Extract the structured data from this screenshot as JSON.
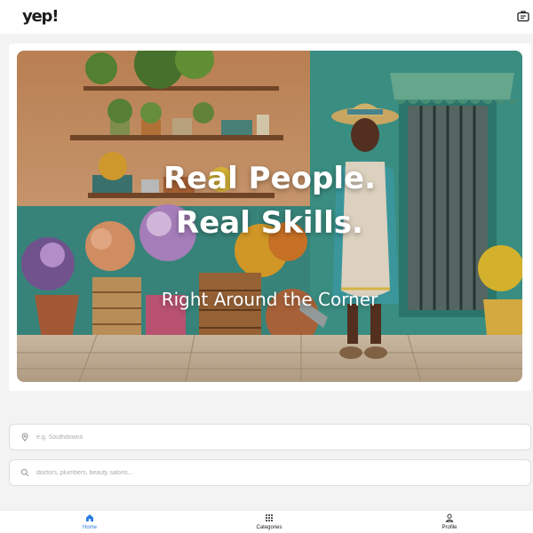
{
  "brand": {
    "logo_text": "yep!",
    "accent_color": "#2b7be0"
  },
  "header": {
    "right_icon": "briefcase-icon"
  },
  "hero": {
    "headline_line1": "Real People.",
    "headline_line2": "Real Skills.",
    "tagline": "Right Around the Corner"
  },
  "search": {
    "location_placeholder": "e.g. Southdowns",
    "location_icon": "map-pin-icon",
    "query_placeholder": "doctors, plumbers, beauty salons...",
    "query_icon": "search-icon"
  },
  "bottom_nav": {
    "items": [
      {
        "label": "Home",
        "icon": "home-icon",
        "active": true
      },
      {
        "label": "Categories",
        "icon": "grid-icon",
        "active": false
      },
      {
        "label": "Profile",
        "icon": "user-icon",
        "active": false
      }
    ]
  }
}
